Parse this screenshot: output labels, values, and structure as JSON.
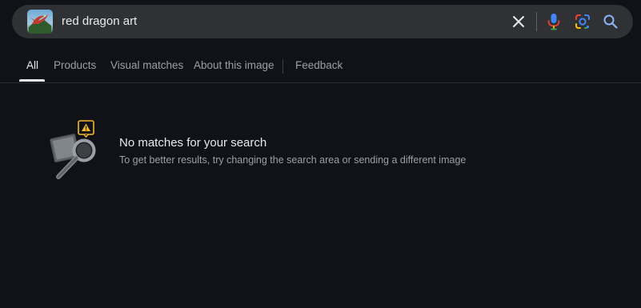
{
  "search": {
    "query": "red dragon art",
    "thumbnail_icon": "dragon-thumbnail-image",
    "clear_icon": "close-icon",
    "voice_icon": "microphone-icon",
    "lens_icon": "google-lens-icon",
    "search_icon": "search-icon"
  },
  "tabs": [
    {
      "label": "All",
      "active": true
    },
    {
      "label": "Products",
      "active": false
    },
    {
      "label": "Visual matches",
      "active": false
    },
    {
      "label": "About this image",
      "active": false
    },
    {
      "label": "Feedback",
      "active": false
    }
  ],
  "empty_state": {
    "illustration_icon": "magnifier-warning-icon",
    "title": "No matches for your search",
    "description": "To get better results, try changing the search area or sending a different image"
  },
  "colors": {
    "background": "#101218",
    "search_bar": "#303134",
    "text_primary": "#e8eaed",
    "text_secondary": "#9aa0a6",
    "warning": "#f2b92b",
    "mic_blue": "#4285f4",
    "mic_red": "#ea4335"
  }
}
